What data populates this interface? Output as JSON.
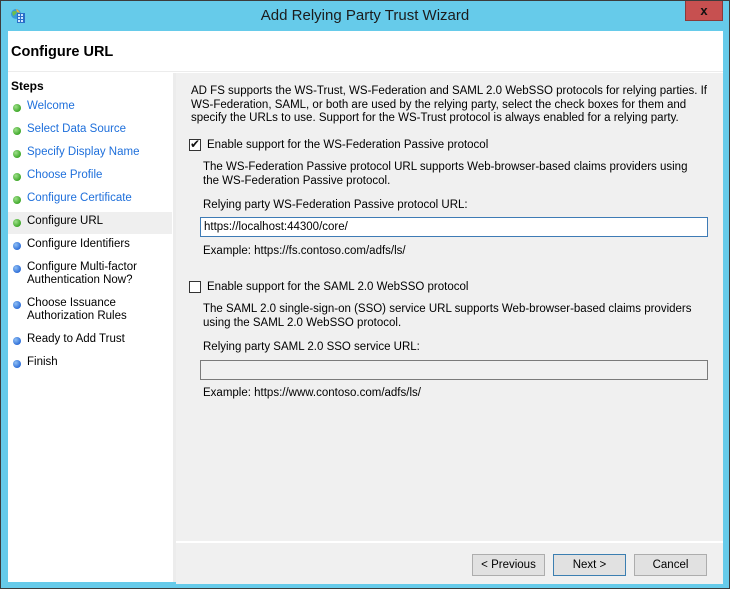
{
  "window": {
    "title": "Add Relying Party Trust Wizard",
    "close_label": "x",
    "accent_color": "#66cbea"
  },
  "header": {
    "title": "Configure URL"
  },
  "steps": {
    "heading": "Steps",
    "items": [
      {
        "label": "Welcome",
        "status": "done"
      },
      {
        "label": "Select Data Source",
        "status": "done"
      },
      {
        "label": "Specify Display Name",
        "status": "done"
      },
      {
        "label": "Choose Profile",
        "status": "done"
      },
      {
        "label": "Configure Certificate",
        "status": "done"
      },
      {
        "label": "Configure URL",
        "status": "current"
      },
      {
        "label": "Configure Identifiers",
        "status": "pending"
      },
      {
        "label": "Configure Multi-factor Authentication Now?",
        "status": "pending"
      },
      {
        "label": "Choose Issuance Authorization Rules",
        "status": "pending"
      },
      {
        "label": "Ready to Add Trust",
        "status": "pending"
      },
      {
        "label": "Finish",
        "status": "pending"
      }
    ]
  },
  "content": {
    "intro": "AD FS supports the WS-Trust, WS-Federation and SAML 2.0 WebSSO protocols for relying parties.  If WS-Federation, SAML, or both are used by the relying party, select the check boxes for them and specify the URLs to use.  Support for the WS-Trust protocol is always enabled for a relying party.",
    "wsfed": {
      "checkbox_label": "Enable support for the WS-Federation Passive protocol",
      "checked": true,
      "description": "The WS-Federation Passive protocol URL supports Web-browser-based claims providers using the WS-Federation Passive protocol.",
      "field_label": "Relying party WS-Federation Passive protocol URL:",
      "value": "https://localhost:44300/core/",
      "example": "Example: https://fs.contoso.com/adfs/ls/"
    },
    "saml": {
      "checkbox_label": "Enable support for the SAML 2.0 WebSSO protocol",
      "checked": false,
      "description": "The SAML 2.0 single-sign-on (SSO) service URL supports Web-browser-based claims providers using the SAML 2.0 WebSSO protocol.",
      "field_label": "Relying party SAML 2.0 SSO service URL:",
      "value": "",
      "example": "Example: https://www.contoso.com/adfs/ls/"
    }
  },
  "footer": {
    "previous_label": "< Previous",
    "next_label": "Next >",
    "cancel_label": "Cancel"
  }
}
